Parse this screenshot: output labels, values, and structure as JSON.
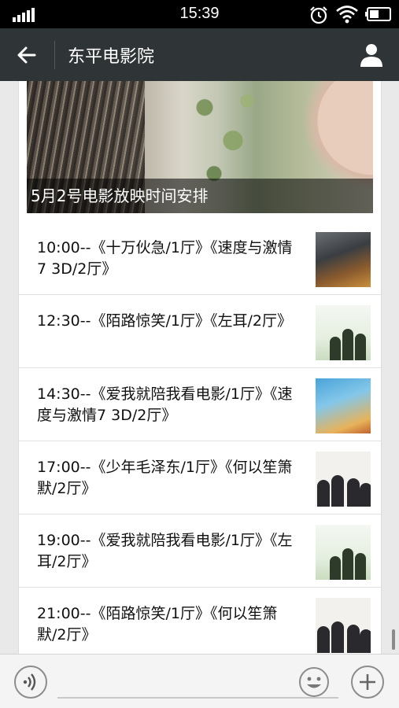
{
  "status_bar": {
    "time": "15:39",
    "icons": [
      "signal-icon",
      "alarm-icon",
      "wifi-icon",
      "battery-icon"
    ]
  },
  "header": {
    "title": "东平电影院",
    "back_icon": "arrow-left-icon",
    "profile_icon": "person-icon"
  },
  "article": {
    "cover_caption": "5月2号电影放映时间安排",
    "schedule": [
      {
        "text": "10:00--《十万伙急/1厅》《速度与激情7 3D/2厅》",
        "thumb": "fast"
      },
      {
        "text": "12:30--《陌路惊笑/1厅》《左耳/2厅》",
        "thumb": "ear"
      },
      {
        "text": "14:30--《爱我就陪我看电影/1厅》《速度与激情7 3D/2厅》",
        "thumb": "love"
      },
      {
        "text": "17:00--《少年毛泽东/1厅》《何以笙箫默/2厅》",
        "thumb": "silent"
      },
      {
        "text": "19:00--《爱我就陪我看电影/1厅》《左耳/2厅》",
        "thumb": "ear"
      },
      {
        "text": "21:00--《陌路惊笑/1厅》《何以笙箫默/2厅》",
        "thumb": "silent"
      }
    ]
  },
  "input_bar": {
    "voice_icon": "voice-icon",
    "emoji_icon": "smiley-icon",
    "plus_icon": "plus-icon"
  },
  "colors": {
    "header_bg": "#2f3437",
    "status_bg": "#000000",
    "page_bg": "#e9e9e9"
  }
}
